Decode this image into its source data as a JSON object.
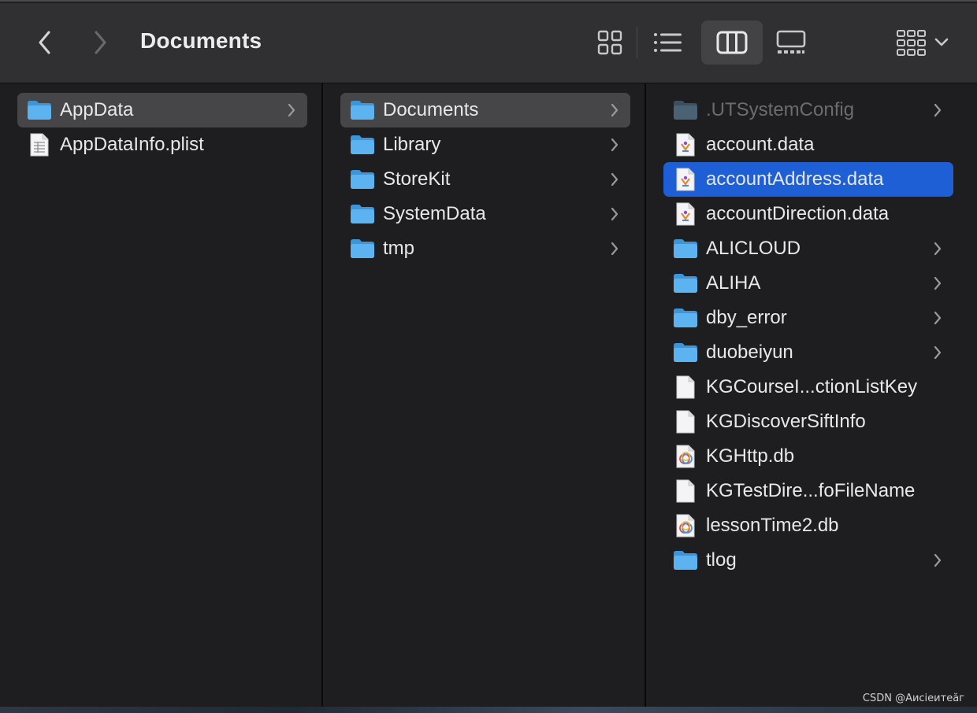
{
  "window": {
    "title": "Documents"
  },
  "toolbar": {
    "back_icon": "chevron-left-icon",
    "forward_icon": "chevron-right-icon",
    "view_modes": [
      "icon-view",
      "list-view",
      "column-view",
      "gallery-view"
    ],
    "active_view": "column-view",
    "group_icon": "group-by-icon"
  },
  "columns": [
    {
      "items": [
        {
          "label": "AppData",
          "kind": "folder",
          "has_children": true,
          "selected": "gray"
        },
        {
          "label": "AppDataInfo.plist",
          "kind": "plist",
          "has_children": false,
          "selected": ""
        }
      ]
    },
    {
      "items": [
        {
          "label": "Documents",
          "kind": "folder",
          "has_children": true,
          "selected": "gray"
        },
        {
          "label": "Library",
          "kind": "folder",
          "has_children": true,
          "selected": ""
        },
        {
          "label": "StoreKit",
          "kind": "folder",
          "has_children": true,
          "selected": ""
        },
        {
          "label": "SystemData",
          "kind": "folder",
          "has_children": true,
          "selected": ""
        },
        {
          "label": "tmp",
          "kind": "folder",
          "has_children": true,
          "selected": ""
        }
      ]
    },
    {
      "items": [
        {
          "label": ".UTSystemConfig",
          "kind": "folder-dim",
          "has_children": true,
          "selected": "",
          "dim": true
        },
        {
          "label": "account.data",
          "kind": "data",
          "has_children": false,
          "selected": ""
        },
        {
          "label": "accountAddress.data",
          "kind": "data",
          "has_children": false,
          "selected": "blue"
        },
        {
          "label": "accountDirection.data",
          "kind": "data",
          "has_children": false,
          "selected": ""
        },
        {
          "label": "ALICLOUD",
          "kind": "folder",
          "has_children": true,
          "selected": ""
        },
        {
          "label": "ALIHA",
          "kind": "folder",
          "has_children": true,
          "selected": ""
        },
        {
          "label": "dby_error",
          "kind": "folder",
          "has_children": true,
          "selected": ""
        },
        {
          "label": "duobeiyun",
          "kind": "folder",
          "has_children": true,
          "selected": ""
        },
        {
          "label": "KGCourseI...ctionListKey",
          "kind": "blank",
          "has_children": false,
          "selected": ""
        },
        {
          "label": "KGDiscoverSiftInfo",
          "kind": "blank",
          "has_children": false,
          "selected": ""
        },
        {
          "label": "KGHttp.db",
          "kind": "db",
          "has_children": false,
          "selected": ""
        },
        {
          "label": "KGTestDire...foFileName",
          "kind": "blank",
          "has_children": false,
          "selected": ""
        },
        {
          "label": "lessonTime2.db",
          "kind": "db",
          "has_children": false,
          "selected": ""
        },
        {
          "label": "tlog",
          "kind": "folder",
          "has_children": true,
          "selected": ""
        }
      ]
    }
  ],
  "watermark": "CSDN @Аисіеитеӑг",
  "colors": {
    "toolbar_bg": "#303032",
    "pane_bg": "#1e1e20",
    "selection_gray": "#464648",
    "selection_blue": "#1e5fd6",
    "folder_blue": "#5cb3f0"
  }
}
